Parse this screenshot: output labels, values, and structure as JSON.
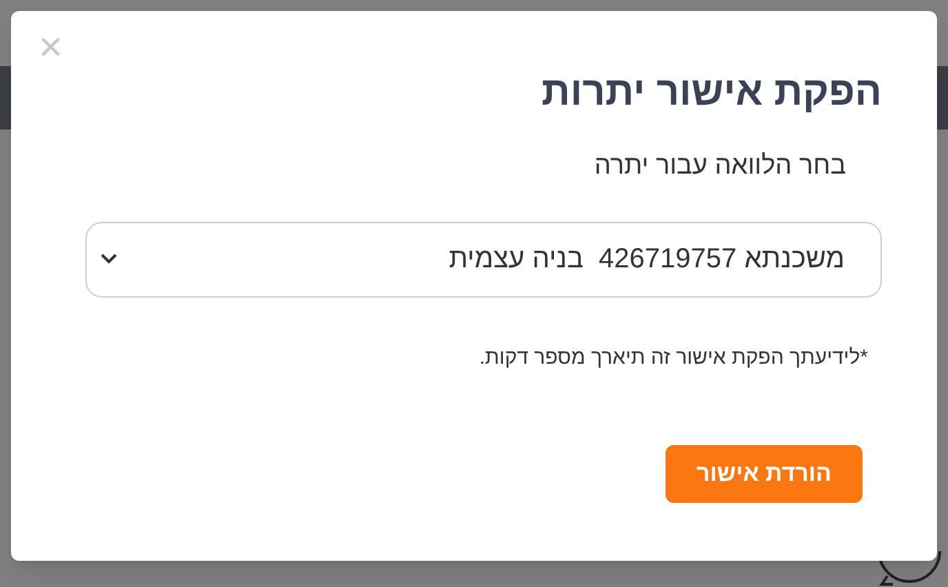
{
  "dialog": {
    "title": "הפקת אישור יתרות",
    "close": "×",
    "label": "בחר הלוואה עבור יתרה",
    "select": {
      "value": "משכנתא 426719757  בניה עצמית"
    },
    "note": "*לידיעתך הפקת אישור זה תיארך מספר דקות.",
    "button": "הורדת אישור"
  }
}
